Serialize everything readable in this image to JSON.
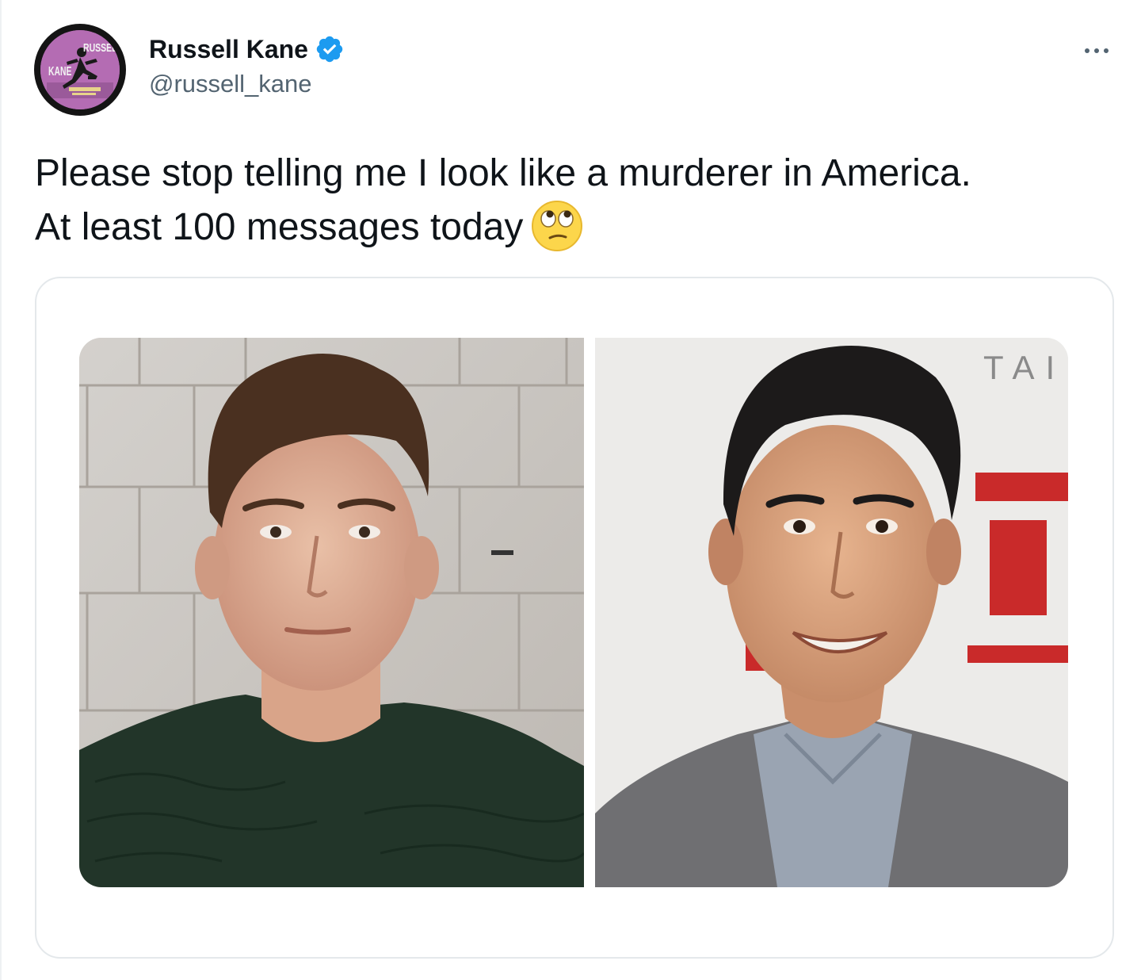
{
  "author": {
    "display_name": "Russell Kane",
    "handle": "@russell_kane",
    "verified": true,
    "avatar_text_top": "RUSSELL",
    "avatar_text_left": "KANE"
  },
  "tweet": {
    "text_line1": "Please stop telling me I look like a murderer in America.",
    "text_line2": "At least 100 messages today",
    "emoji": "face-with-rolling-eyes-emoji"
  },
  "media": {
    "left_photo": "mugshot-photo",
    "right_photo": "red-carpet-photo",
    "right_watermark": "TAI"
  },
  "colors": {
    "text": "#0f1419",
    "secondary": "#536471",
    "verified_blue": "#1d9bf0",
    "card_border": "#e4e8eb"
  }
}
